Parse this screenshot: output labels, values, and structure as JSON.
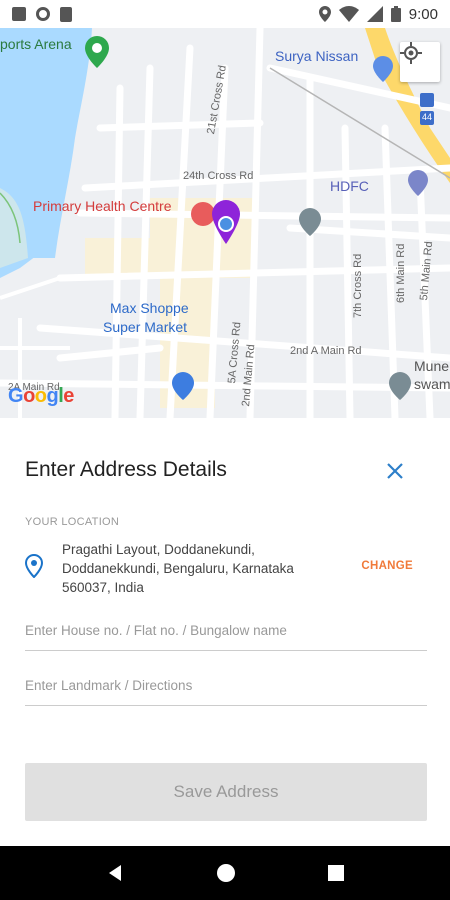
{
  "status_bar": {
    "time": "9:00"
  },
  "map": {
    "labels": {
      "sports_arena": "ports Arena",
      "surya_nissan": "Surya Nissan",
      "cross_21": "21st Cross Rd",
      "cross_24": "24th Cross Rd",
      "hdfc": "HDFC",
      "primary_health": "Primary Health Centre",
      "max_shoppe": "Max Shoppe",
      "super_market": "Super Market",
      "cross_7": "7th Cross Rd",
      "main_6": "6th Main Rd",
      "main_5": "5th Main Rd",
      "cross_5a": "5A Cross Rd",
      "main_2nd": "2nd Main Rd",
      "main_2a": "2nd A Main Rd",
      "main_2a_left": "2A Main Rd",
      "mune": "Mune",
      "swam": "swam",
      "route_44": "44"
    },
    "google": "Google"
  },
  "sheet": {
    "title": "Enter Address Details",
    "section_label": "YOUR LOCATION",
    "address": "Pragathi Layout, Doddanekundi, Doddanekkundi, Bengaluru, Karnataka 560037, India",
    "change_label": "CHANGE",
    "house_placeholder": "Enter House no. / Flat no. / Bungalow name",
    "landmark_placeholder": "Enter Landmark / Directions",
    "save_label": "Save Address"
  },
  "colors": {
    "accent": "#f07a3a",
    "pin": "#1a73c9",
    "marker": "#8e24d9"
  }
}
